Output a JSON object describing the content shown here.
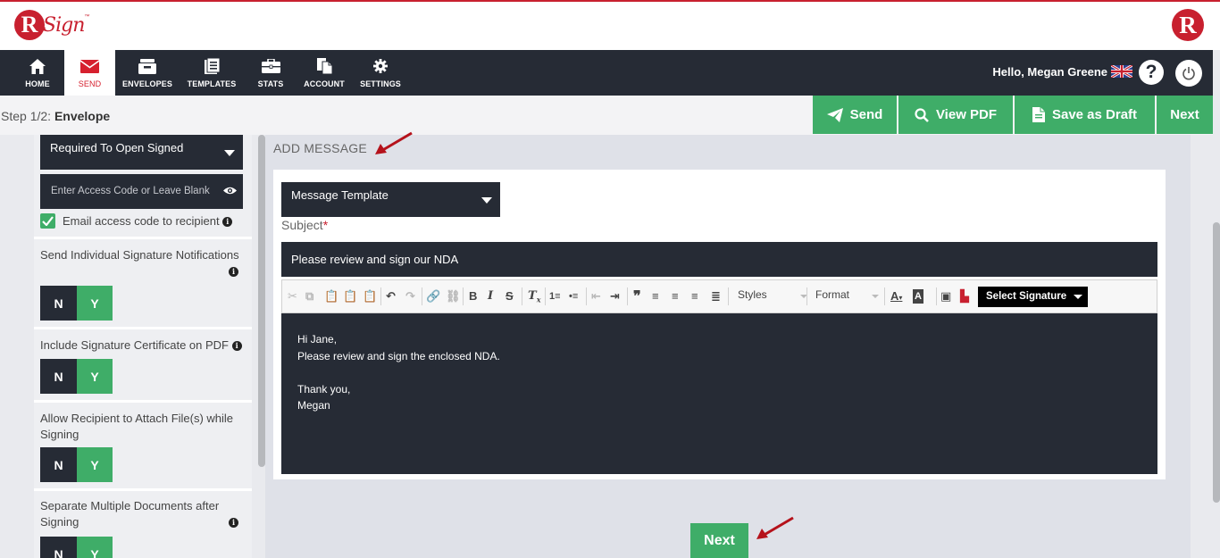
{
  "nav": {
    "items": [
      {
        "label": "HOME",
        "icon": "home-icon"
      },
      {
        "label": "SEND",
        "icon": "envelope-icon"
      },
      {
        "label": "ENVELOPES",
        "icon": "inbox-icon"
      },
      {
        "label": "TEMPLATES",
        "icon": "templates-icon"
      },
      {
        "label": "STATS",
        "icon": "briefcase-icon"
      },
      {
        "label": "ACCOUNT",
        "icon": "account-icon"
      },
      {
        "label": "SETTINGS",
        "icon": "gear-icon"
      }
    ],
    "active": "SEND",
    "greeting": "Hello, Megan Greene",
    "help_glyph": "?"
  },
  "step": {
    "prefix": "Step 1/2:",
    "name": "Envelope"
  },
  "actions": {
    "send": "Send",
    "view_pdf": "View PDF",
    "save_draft": "Save as Draft",
    "next": "Next"
  },
  "left": {
    "password_option": "Required To Open Signed",
    "access_code_placeholder": "Enter Access Code or Leave Blank",
    "email_access_code": "Email access code to recipient",
    "options": [
      {
        "label": "Send Individual Signature Notifications",
        "n": "N",
        "y": "Y"
      },
      {
        "label": "Include Signature Certificate on PDF",
        "n": "N",
        "y": "Y"
      },
      {
        "label": "Allow Recipient to Attach File(s) while Signing",
        "n": "N",
        "y": "Y"
      },
      {
        "label": "Separate Multiple Documents after Signing",
        "n": "N",
        "y": "Y"
      }
    ]
  },
  "message": {
    "section_title": "ADD MESSAGE",
    "template_label": "Message Template",
    "subject_label": "Subject",
    "required_mark": "*",
    "subject_value": "Please review and sign our NDA",
    "toolbar": {
      "styles": "Styles",
      "format": "Format",
      "select_signature": "Select Signature"
    },
    "body_lines": [
      "Hi Jane,",
      "Please review and sign the enclosed NDA.",
      "",
      "Thank you,",
      "Megan"
    ],
    "next": "Next"
  },
  "colors": {
    "brand_red": "#c8202f",
    "green": "#3fad68",
    "dark": "#262b35"
  }
}
